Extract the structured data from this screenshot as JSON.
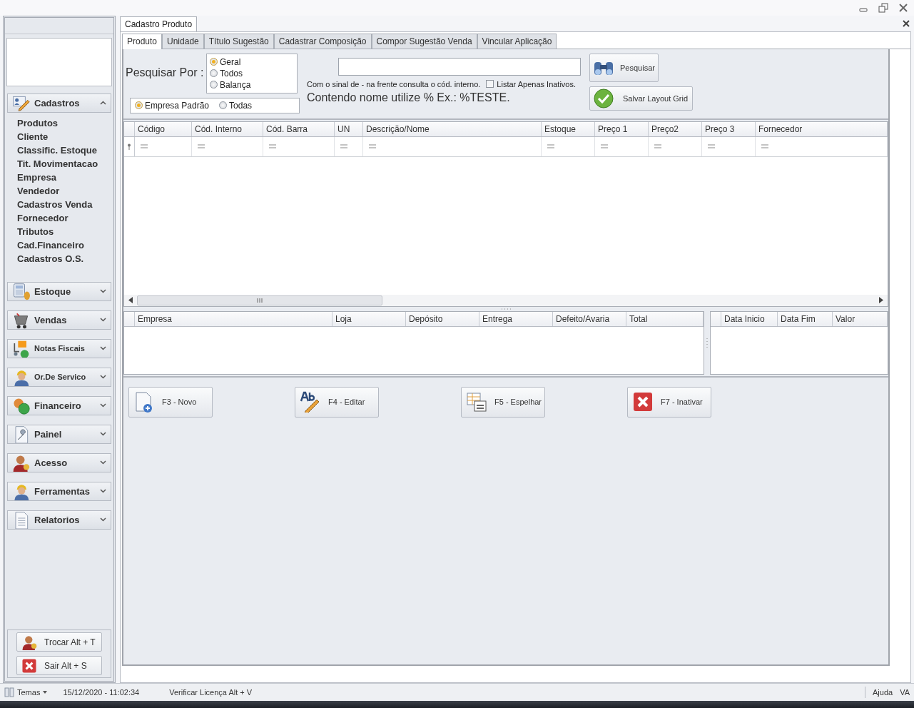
{
  "sidebar": {
    "groups": [
      {
        "label": "Cadastros",
        "expanded": true,
        "children": [
          {
            "label": "Produtos"
          },
          {
            "label": "Cliente"
          },
          {
            "label": "Classific. Estoque"
          },
          {
            "label": "Tit. Movimentacao"
          },
          {
            "label": "Empresa"
          },
          {
            "label": "Vendedor"
          },
          {
            "label": "Cadastros Venda"
          },
          {
            "label": "Fornecedor"
          },
          {
            "label": "Tributos"
          },
          {
            "label": "Cad.Financeiro"
          },
          {
            "label": "Cadastros O.S."
          }
        ]
      },
      {
        "label": "Estoque",
        "expanded": false
      },
      {
        "label": "Vendas",
        "expanded": false
      },
      {
        "label": "Notas Fiscais",
        "expanded": false
      },
      {
        "label": "Or.De Servico",
        "expanded": false
      },
      {
        "label": "Financeiro",
        "expanded": false
      },
      {
        "label": "Painel",
        "expanded": false
      },
      {
        "label": "Acesso",
        "expanded": false
      },
      {
        "label": "Ferramentas",
        "expanded": false
      },
      {
        "label": "Relatorios",
        "expanded": false
      }
    ],
    "footer_buttons": [
      "Trocar Alt + T",
      "Sair Alt + S"
    ]
  },
  "document_tab": {
    "label": "Cadastro Produto"
  },
  "tabs": [
    {
      "label": "Produto",
      "selected": true
    },
    {
      "label": "Unidade",
      "selected": false
    },
    {
      "label": "Título Sugestão",
      "selected": false
    },
    {
      "label": "Cadastrar Composição",
      "selected": false
    },
    {
      "label": "Compor Sugestão Venda",
      "selected": false
    },
    {
      "label": "Vincular Aplicação",
      "selected": false
    }
  ],
  "search": {
    "label": "Pesquisar Por :",
    "options": [
      {
        "label": "Geral",
        "selected": true
      },
      {
        "label": "Todos",
        "selected": false
      },
      {
        "label": "Balança",
        "selected": false
      }
    ],
    "scope": [
      {
        "label": "Empresa Padrão",
        "selected": true
      },
      {
        "label": "Todas",
        "selected": false
      }
    ],
    "hint": "Com o sinal de - na frente consulta o cód. interno.",
    "inactive_only": {
      "label": "Listar Apenas Inativos.",
      "checked": false
    },
    "tip": "Contendo nome utilize % Ex.: %TESTE.",
    "buttons": [
      "Pesquisar",
      "Salvar Layout Grid"
    ]
  },
  "product_grid": {
    "columns": [
      "Código",
      "Cód. Interno",
      "Cód. Barra",
      "UN",
      "Descrição/Nome",
      "Estoque",
      "Preço 1",
      "Preço2",
      "Preço 3",
      "Fornecedor"
    ]
  },
  "stock_grid": {
    "columns": [
      "Empresa",
      "Loja",
      "Depósito",
      "Entrega",
      "Defeito/Avaria",
      "Total"
    ]
  },
  "period_grid": {
    "columns": [
      "Data Inicio",
      "Data  Fim",
      "Valor"
    ]
  },
  "actions": [
    "F3 - Novo",
    "F4 - Editar",
    "F5 - Espelhar",
    "F7 - Inativar"
  ],
  "status_bar": {
    "theme": "Temas",
    "datetime": "15/12/2020 - 11:02:34",
    "license": "Verificar Licença Alt + V",
    "help": "Ajuda",
    "user": "VA"
  }
}
